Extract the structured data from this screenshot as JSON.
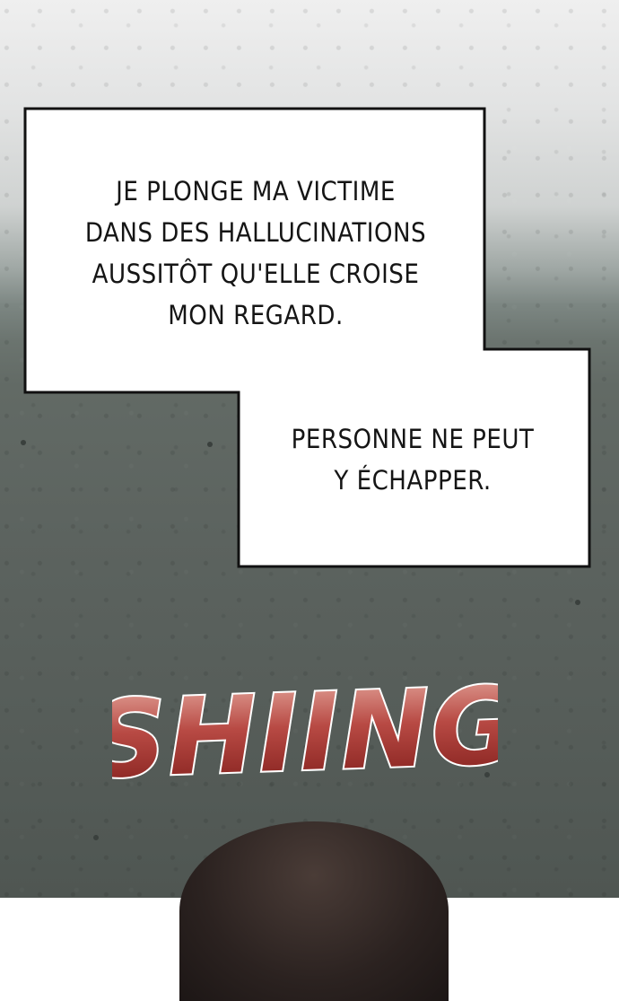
{
  "captions": [
    {
      "lines": [
        "JE PLONGE MA VICTIME",
        "DANS DES HALLUCINATIONS",
        "AUSSITÔT QU'ELLE CROISE",
        "MON REGARD."
      ]
    },
    {
      "lines": [
        "PERSONNE NE PEUT",
        "Y ÉCHAPPER."
      ]
    }
  ],
  "sfx": {
    "text": "SHIING",
    "fill_top": "#e9b1a6",
    "fill_bottom": "#7d1b18",
    "outline": "#ffffff"
  },
  "colors": {
    "bubble": "#ffffff",
    "bubble_border": "#111111",
    "text": "#151515"
  }
}
